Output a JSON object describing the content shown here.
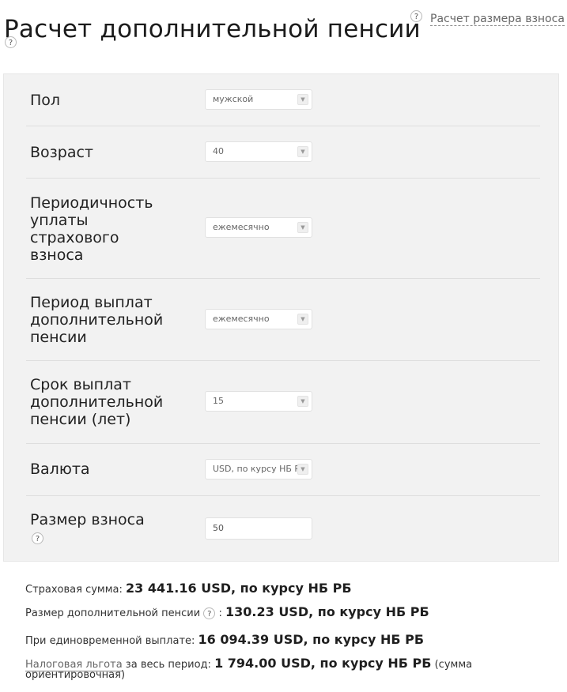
{
  "header": {
    "title": "Расчет дополнительной пенсии",
    "help": "?",
    "link": "Расчет размера взноса"
  },
  "form": {
    "gender": {
      "label": "Пол",
      "value": "мужской"
    },
    "age": {
      "label": "Возраст",
      "value": "40"
    },
    "payment_frequency": {
      "label": "Периодичность уплаты страхового взноса",
      "value": "ежемесячно"
    },
    "payout_period": {
      "label": "Период выплат дополнительной пенсии",
      "value": "ежемесячно"
    },
    "payout_term": {
      "label": "Срок выплат дополнительной пенсии (лет)",
      "value": "15"
    },
    "currency": {
      "label": "Валюта",
      "value": "USD, по курсу НБ РБ"
    },
    "contribution": {
      "label": "Размер взноса",
      "value": "50"
    },
    "arrow_glyph": "▼"
  },
  "results": {
    "insured_sum": {
      "label": "Страховая сумма:",
      "value": "23 441.16 USD, по курсу НБ РБ"
    },
    "pension_size": {
      "label": "Размер дополнительной пенсии",
      "label_suffix": ":",
      "value": "130.23 USD, по курсу НБ РБ"
    },
    "lump_sum": {
      "label": "При единовременной выплате:",
      "value": "16 094.39 USD, по курсу НБ РБ"
    },
    "tax_benefit": {
      "link": "Налоговая льгота",
      "label": " за весь период:",
      "value": "1 794.00 USD, по курсу НБ РБ",
      "note_line1": "(сумма",
      "note_line2": "ориентировочная)"
    }
  }
}
